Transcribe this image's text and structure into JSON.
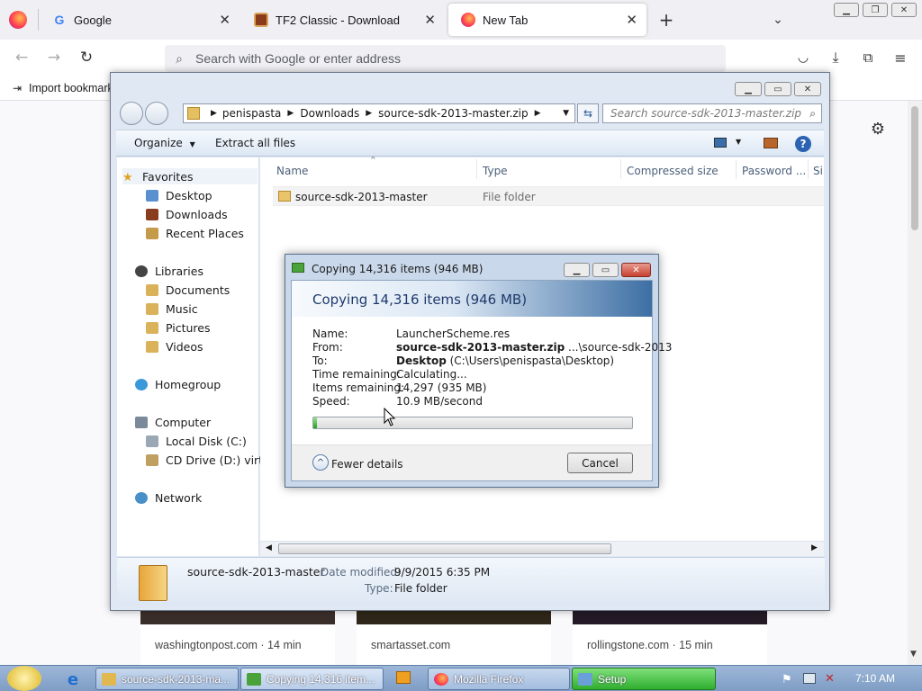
{
  "firefox": {
    "tabs": [
      {
        "label": "Google"
      },
      {
        "label": "TF2 Classic - Download"
      },
      {
        "label": "New Tab"
      }
    ],
    "url_placeholder": "Search with Google or enter address",
    "bookmark_import": "Import bookmark"
  },
  "news_cards": [
    {
      "source": "washingtonpost.com · 14 min"
    },
    {
      "source": "smartasset.com"
    },
    {
      "source": "rollingstone.com · 15 min"
    }
  ],
  "explorer": {
    "breadcrumb": [
      "penispasta",
      "Downloads",
      "source-sdk-2013-master.zip"
    ],
    "search_placeholder": "Search source-sdk-2013-master.zip",
    "toolbar": {
      "organize": "Organize",
      "extract": "Extract all files"
    },
    "nav": {
      "favorites": "Favorites",
      "desktop": "Desktop",
      "downloads": "Downloads",
      "recent": "Recent Places",
      "libraries": "Libraries",
      "documents": "Documents",
      "music": "Music",
      "pictures": "Pictures",
      "videos": "Videos",
      "homegroup": "Homegroup",
      "computer": "Computer",
      "local_disk": "Local Disk (C:)",
      "cd_drive": "CD Drive (D:) virtio-w",
      "network": "Network"
    },
    "columns": [
      "Name",
      "Type",
      "Compressed size",
      "Password ...",
      "Si"
    ],
    "files": [
      {
        "name": "source-sdk-2013-master",
        "type": "File folder"
      }
    ],
    "details": {
      "name": "source-sdk-2013-master",
      "modified_label": "Date modified:",
      "modified_value": "9/9/2015 6:35 PM",
      "type_label": "Type:",
      "type_value": "File folder"
    }
  },
  "copy_dialog": {
    "title": "Copying 14,316 items (946 MB)",
    "heading": "Copying 14,316 items (946 MB)",
    "labels": {
      "name": "Name:",
      "from": "From:",
      "to": "To:",
      "time": "Time remaining:",
      "items": "Items remaining:",
      "speed": "Speed:"
    },
    "values": {
      "name": "LauncherScheme.res",
      "from_bold": "source-sdk-2013-master.zip",
      "from_rest": " ...\\source-sdk-2013",
      "to_bold": "Desktop",
      "to_rest": " (C:\\Users\\penispasta\\Desktop)",
      "time": "Calculating...",
      "items": "14,297 (935 MB)",
      "speed": "10.9 MB/second"
    },
    "progress": 0.01,
    "fewer_details": "Fewer details",
    "cancel": "Cancel"
  },
  "taskbar": {
    "buttons": [
      {
        "label": "source-sdk-2013-ma..."
      },
      {
        "label": "Copying 14,316 item..."
      },
      {
        "label": "Mozilla Firefox"
      },
      {
        "label": "Setup"
      }
    ],
    "clock": "7:10 AM"
  },
  "colors": {
    "accent": "#0060df",
    "progress": "#23a11a",
    "setup_button": "#3fbf3f"
  }
}
